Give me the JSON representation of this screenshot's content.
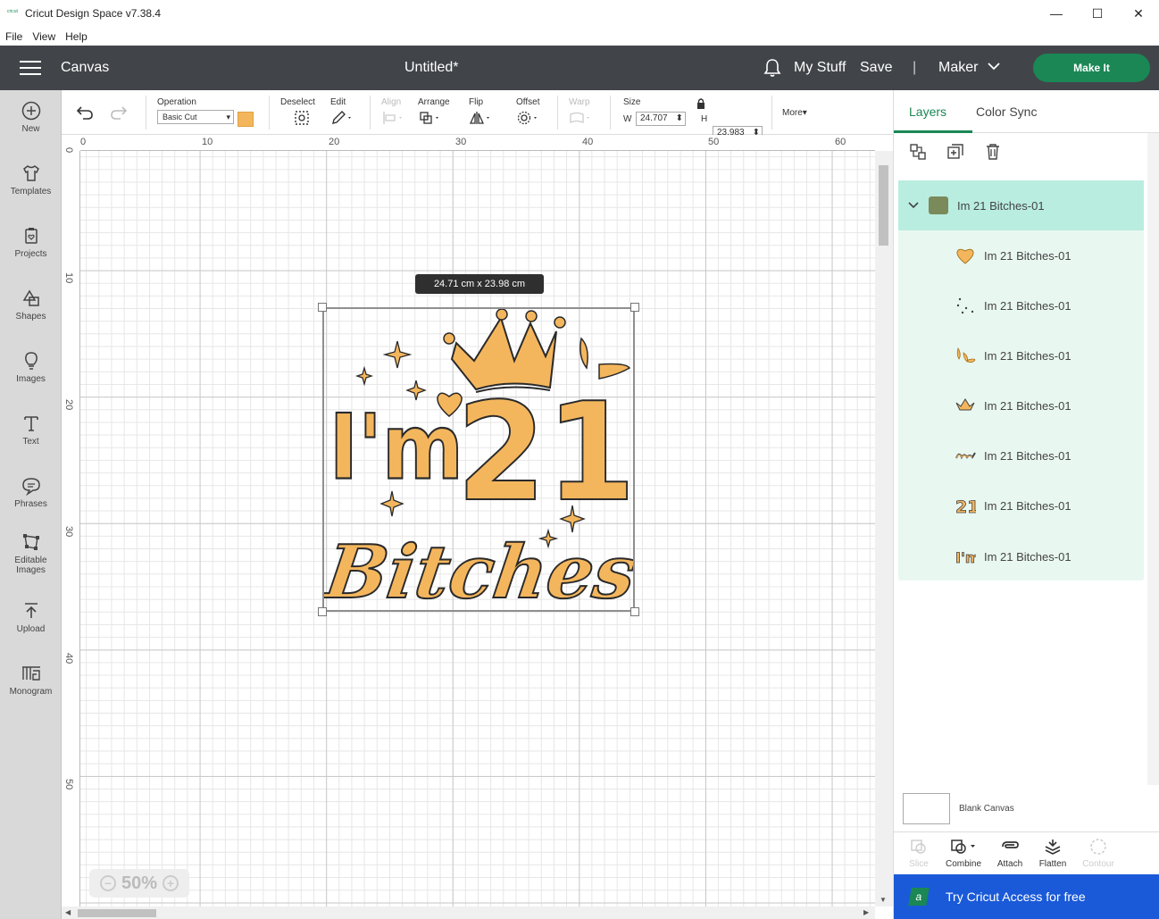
{
  "window": {
    "title": "Cricut Design Space  v7.38.4",
    "controls": {
      "minimize": "—",
      "maximize": "☐",
      "close": "✕"
    }
  },
  "menu": [
    "File",
    "View",
    "Help"
  ],
  "header": {
    "section": "Canvas",
    "doc_title": "Untitled*",
    "my_stuff": "My Stuff",
    "save": "Save",
    "separator": "|",
    "machine": "Maker",
    "make_it": "Make It"
  },
  "sidebar": {
    "items": [
      {
        "label": "New",
        "icon": "plus-circle-icon"
      },
      {
        "label": "Templates",
        "icon": "shirt-icon"
      },
      {
        "label": "Projects",
        "icon": "projects-icon"
      },
      {
        "label": "Shapes",
        "icon": "shapes-icon"
      },
      {
        "label": "Images",
        "icon": "lightbulb-icon"
      },
      {
        "label": "Text",
        "icon": "text-icon"
      },
      {
        "label": "Phrases",
        "icon": "speech-bubble-icon"
      },
      {
        "label": "Editable Images",
        "icon": "editable-images-icon"
      },
      {
        "label": "Upload",
        "icon": "upload-icon"
      },
      {
        "label": "Monogram",
        "icon": "monogram-icon"
      }
    ]
  },
  "toolbar": {
    "operation_label": "Operation",
    "operation_value": "Basic Cut",
    "operation_color": "#f4b65d",
    "deselect": "Deselect",
    "edit": "Edit",
    "align": "Align",
    "arrange": "Arrange",
    "flip": "Flip",
    "offset": "Offset",
    "warp": "Warp",
    "size": "Size",
    "w_label": "W",
    "w_value": "24.707",
    "h_label": "H",
    "h_value": "23.983",
    "more": "More▾"
  },
  "canvas": {
    "ruler_top": [
      "0",
      "10",
      "20",
      "30",
      "40",
      "50",
      "60"
    ],
    "ruler_left": [
      "0",
      "10",
      "20",
      "30",
      "40",
      "50"
    ],
    "size_tooltip": "24.71  cm x 23.98  cm",
    "zoom": "50%",
    "design_colors": {
      "fill": "#f4b65d",
      "stroke": "#2a2a2a"
    },
    "design_text": {
      "line1": "I'm",
      "line2": "21",
      "line3": "Bitches!"
    }
  },
  "right_panel": {
    "tabs": [
      "Layers",
      "Color Sync"
    ],
    "active_tab": "Layers",
    "layer_tools": [
      "group-icon",
      "duplicate-icon",
      "delete-icon"
    ],
    "group": {
      "name": "Im 21 Bitches-01"
    },
    "layers": [
      {
        "name": "Im 21 Bitches-01",
        "thumb": "heart"
      },
      {
        "name": "Im 21 Bitches-01",
        "thumb": "dots"
      },
      {
        "name": "Im 21 Bitches-01",
        "thumb": "splash"
      },
      {
        "name": "Im 21 Bitches-01",
        "thumb": "crown"
      },
      {
        "name": "Im 21 Bitches-01",
        "thumb": "bitches"
      },
      {
        "name": "Im 21 Bitches-01",
        "thumb": "21"
      },
      {
        "name": "Im 21 Bitches-01",
        "thumb": "im"
      }
    ],
    "blank_canvas": "Blank Canvas",
    "bottom_tools": [
      {
        "label": "Slice",
        "enabled": false
      },
      {
        "label": "Combine",
        "enabled": true
      },
      {
        "label": "Attach",
        "enabled": true
      },
      {
        "label": "Flatten",
        "enabled": true
      },
      {
        "label": "Contour",
        "enabled": false
      }
    ],
    "access_banner": "Try Cricut Access for free"
  }
}
